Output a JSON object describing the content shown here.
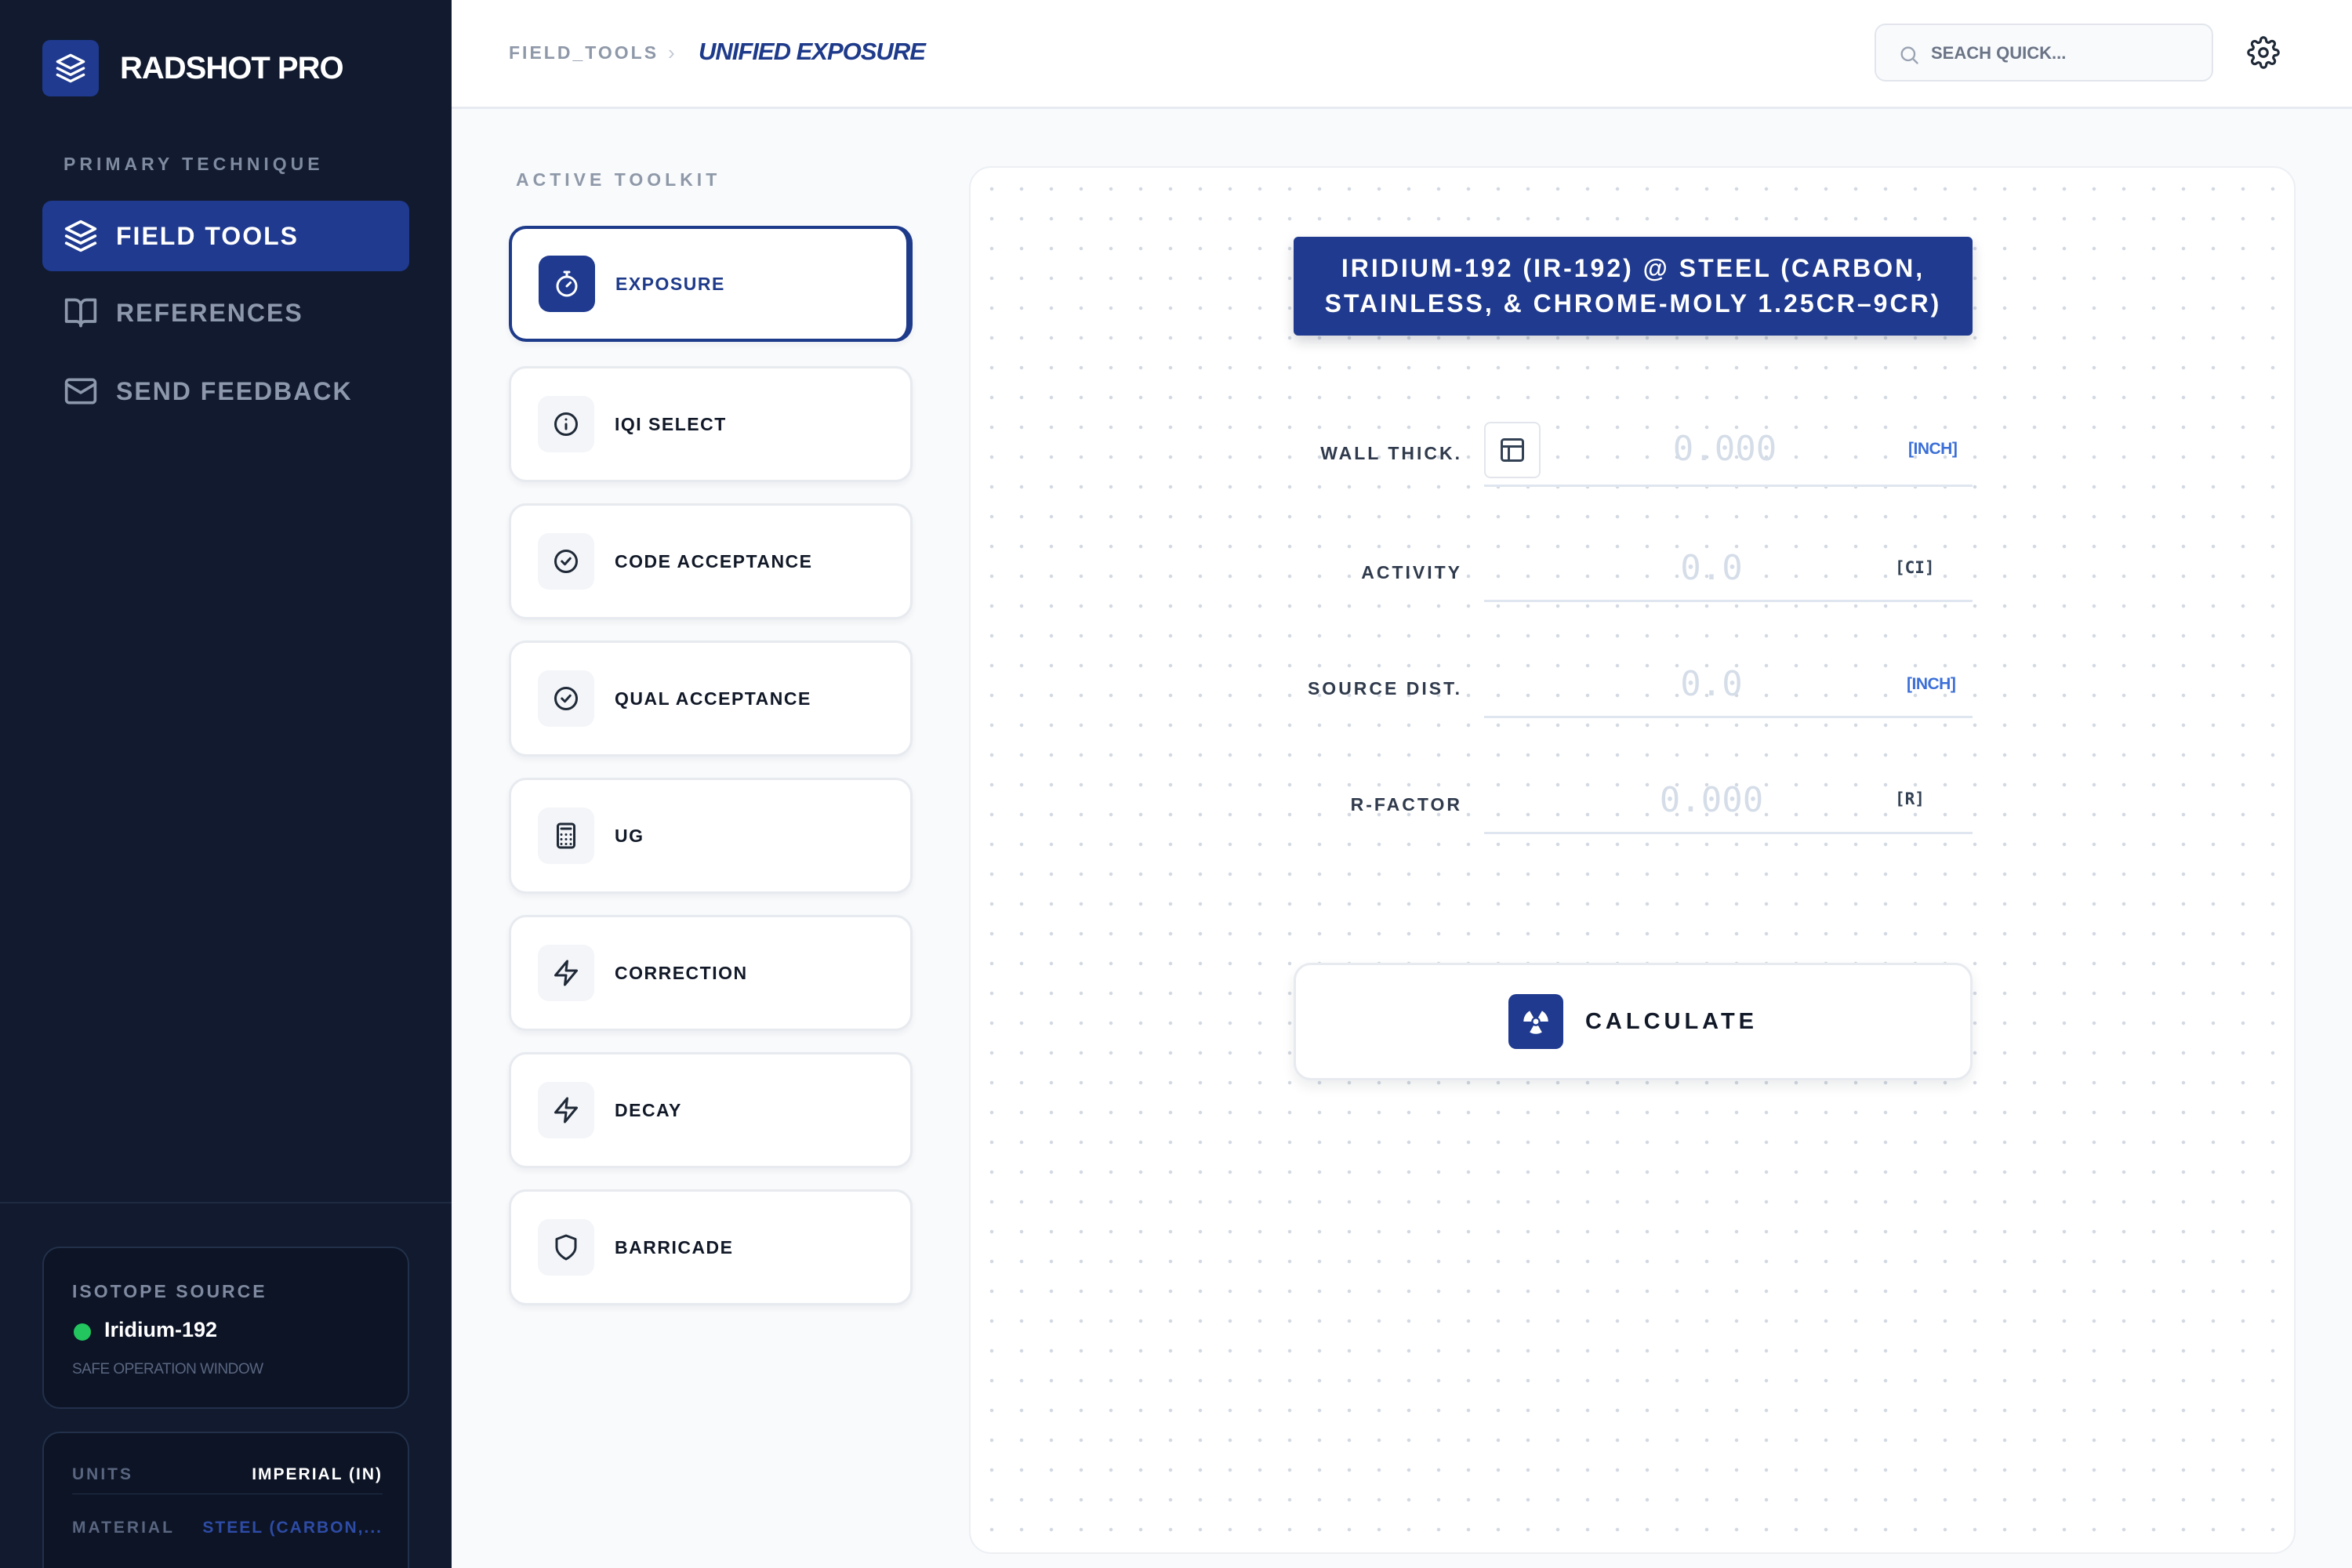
{
  "app": {
    "title": "RADSHOT PRO",
    "logo_icon": "layers-icon"
  },
  "sidebar": {
    "section_label": "PRIMARY TECHNIQUE",
    "nav": [
      {
        "label": "FIELD TOOLS",
        "icon": "layers-icon",
        "active": true
      },
      {
        "label": "REFERENCES",
        "icon": "book-open-icon",
        "active": false
      },
      {
        "label": "SEND FEEDBACK",
        "icon": "mail-icon",
        "active": false
      }
    ],
    "isotope": {
      "label": "ISOTOPE SOURCE",
      "name": "Iridium-192",
      "status": "SAFE OPERATION WINDOW",
      "status_color": "#22c55e"
    },
    "settings": {
      "units_label": "UNITS",
      "units_value": "IMPERIAL (IN)",
      "material_label": "MATERIAL",
      "material_value": "STEEL (CARBON,..."
    }
  },
  "topbar": {
    "breadcrumb_root": "FIELD_TOOLS",
    "breadcrumb_separator": "›",
    "breadcrumb_current": "UNIFIED EXPOSURE",
    "search_placeholder": "SEACH QUICK...",
    "search_value": ""
  },
  "toolkit": {
    "label": "ACTIVE TOOLKIT",
    "tools": [
      {
        "label": "EXPOSURE",
        "icon": "stopwatch-icon",
        "active": true
      },
      {
        "label": "IQI SELECT",
        "icon": "info-icon",
        "active": false
      },
      {
        "label": "CODE ACCEPTANCE",
        "icon": "check-circle-icon",
        "active": false
      },
      {
        "label": "QUAL ACCEPTANCE",
        "icon": "check-circle-icon",
        "active": false
      },
      {
        "label": "UG",
        "icon": "calculator-icon",
        "active": false
      },
      {
        "label": "CORRECTION",
        "icon": "lightning-icon",
        "active": false
      },
      {
        "label": "DECAY",
        "icon": "lightning-icon",
        "active": false
      },
      {
        "label": "BARRICADE",
        "icon": "shield-icon",
        "active": false
      }
    ]
  },
  "main": {
    "banner": "IRIDIUM-192 (IR-192) @ STEEL (CARBON, STAINLESS, & CHROME-MOLY 1.25CR–9CR)",
    "fields": {
      "wall": {
        "label": "WALL THICK.",
        "placeholder": "0.000",
        "value": "",
        "unit": "[INCH]"
      },
      "activity": {
        "label": "ACTIVITY",
        "placeholder": "0.0",
        "value": "",
        "unit": "[CI]"
      },
      "distance": {
        "label": "SOURCE DIST.",
        "placeholder": "0.0",
        "value": "",
        "unit": "[INCH]"
      },
      "rfactor": {
        "label": "R-FACTOR",
        "placeholder": "0.000",
        "value": "",
        "unit": "[R]"
      }
    },
    "calculate_label": "CALCULATE",
    "calculate_icon": "radiation-icon"
  },
  "colors": {
    "sidebar_bg": "#111a2e",
    "accent": "#1f3a8f",
    "accent_text": "#1e3a8a",
    "unit_blue": "#3b6fd8",
    "status_green": "#22c55e"
  }
}
